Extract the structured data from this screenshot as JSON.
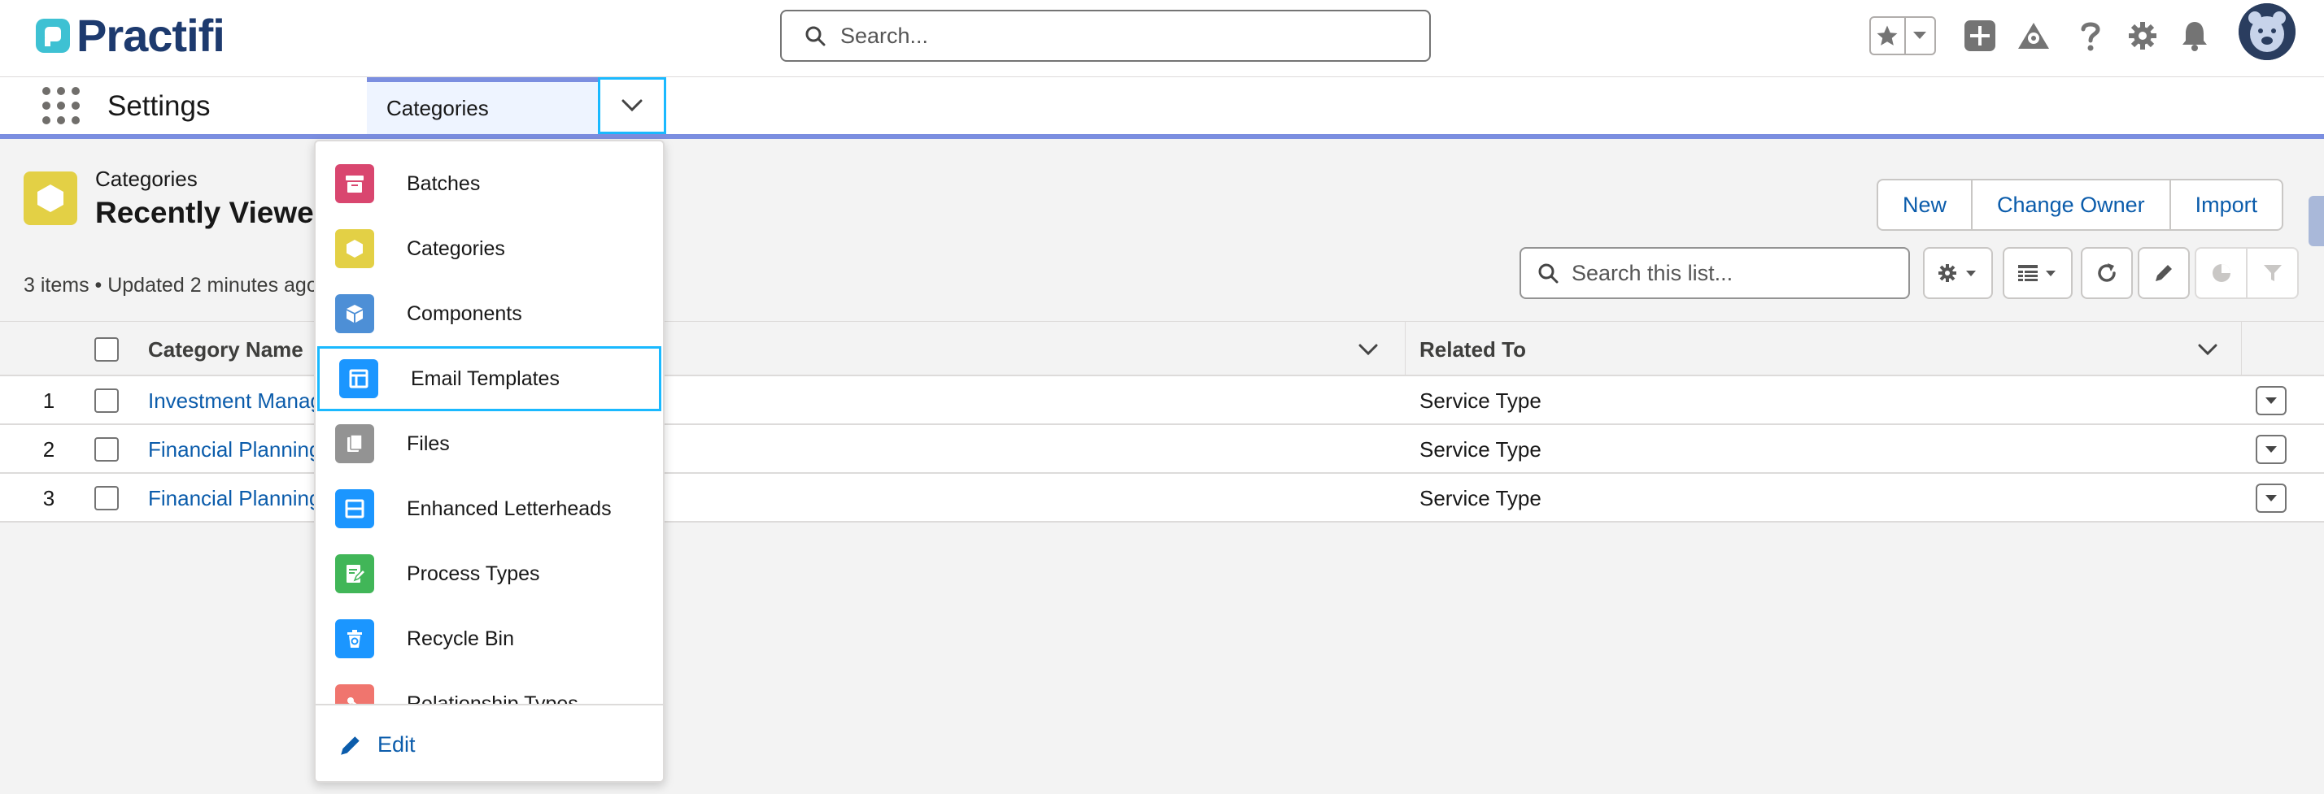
{
  "brand": {
    "name": "Practifi",
    "color": "#1d3a6e",
    "accent": "#3ec1d3"
  },
  "header": {
    "search_placeholder": "Search...",
    "icons": [
      "favorites-star-icon",
      "favorites-caret-icon",
      "global-add-icon",
      "trailhead-icon",
      "help-icon",
      "setup-gear-icon",
      "notifications-bell-icon",
      "user-avatar"
    ]
  },
  "nav": {
    "app_name": "Settings",
    "active_tab": "Categories"
  },
  "list": {
    "object_label": "Categories",
    "title": "Recently Viewed",
    "meta": "3 items • Updated 2 minutes ago",
    "buttons": [
      "New",
      "Change Owner",
      "Import"
    ],
    "search_placeholder": "Search this list...",
    "columns": [
      "Category Name",
      "Related To"
    ],
    "rows": [
      {
        "num": "1",
        "name": "Investment Management",
        "related": "Service Type"
      },
      {
        "num": "2",
        "name": "Financial Planning",
        "related": "Service Type"
      },
      {
        "num": "3",
        "name": "Financial Planning",
        "related": "Service Type"
      }
    ]
  },
  "dropdown": {
    "items": [
      {
        "label": "Batches",
        "icon": "batches-icon",
        "color": "#d9466f"
      },
      {
        "label": "Categories",
        "icon": "categories-icon",
        "color": "#e3d045"
      },
      {
        "label": "Components",
        "icon": "components-icon",
        "color": "#4d8fd6"
      },
      {
        "label": "Email Templates",
        "icon": "email-templates-icon",
        "color": "#1b96ff"
      },
      {
        "label": "Files",
        "icon": "files-icon",
        "color": "#939393"
      },
      {
        "label": "Enhanced Letterheads",
        "icon": "letterheads-icon",
        "color": "#1b96ff"
      },
      {
        "label": "Process Types",
        "icon": "process-types-icon",
        "color": "#41b658"
      },
      {
        "label": "Recycle Bin",
        "icon": "recycle-bin-icon",
        "color": "#1b96ff"
      },
      {
        "label": "Relationship Types",
        "icon": "relationship-types-icon",
        "color": "#f0756e"
      }
    ],
    "focused_item": "Email Templates",
    "edit_label": "Edit"
  }
}
